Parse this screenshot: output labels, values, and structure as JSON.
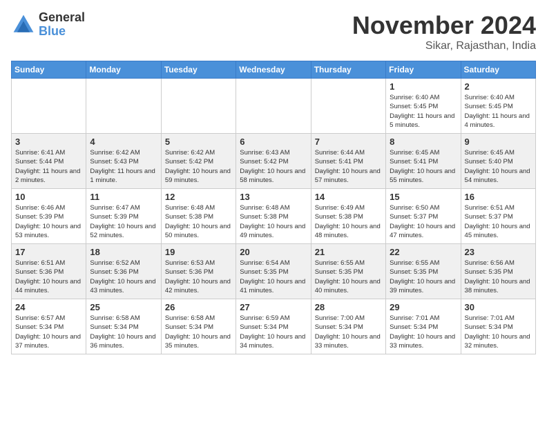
{
  "logo": {
    "general": "General",
    "blue": "Blue"
  },
  "title": "November 2024",
  "location": "Sikar, Rajasthan, India",
  "days_of_week": [
    "Sunday",
    "Monday",
    "Tuesday",
    "Wednesday",
    "Thursday",
    "Friday",
    "Saturday"
  ],
  "weeks": [
    [
      {
        "day": "",
        "info": ""
      },
      {
        "day": "",
        "info": ""
      },
      {
        "day": "",
        "info": ""
      },
      {
        "day": "",
        "info": ""
      },
      {
        "day": "",
        "info": ""
      },
      {
        "day": "1",
        "info": "Sunrise: 6:40 AM\nSunset: 5:45 PM\nDaylight: 11 hours\nand 5 minutes."
      },
      {
        "day": "2",
        "info": "Sunrise: 6:40 AM\nSunset: 5:45 PM\nDaylight: 11 hours\nand 4 minutes."
      }
    ],
    [
      {
        "day": "3",
        "info": "Sunrise: 6:41 AM\nSunset: 5:44 PM\nDaylight: 11 hours\nand 2 minutes."
      },
      {
        "day": "4",
        "info": "Sunrise: 6:42 AM\nSunset: 5:43 PM\nDaylight: 11 hours\nand 1 minute."
      },
      {
        "day": "5",
        "info": "Sunrise: 6:42 AM\nSunset: 5:42 PM\nDaylight: 10 hours\nand 59 minutes."
      },
      {
        "day": "6",
        "info": "Sunrise: 6:43 AM\nSunset: 5:42 PM\nDaylight: 10 hours\nand 58 minutes."
      },
      {
        "day": "7",
        "info": "Sunrise: 6:44 AM\nSunset: 5:41 PM\nDaylight: 10 hours\nand 57 minutes."
      },
      {
        "day": "8",
        "info": "Sunrise: 6:45 AM\nSunset: 5:41 PM\nDaylight: 10 hours\nand 55 minutes."
      },
      {
        "day": "9",
        "info": "Sunrise: 6:45 AM\nSunset: 5:40 PM\nDaylight: 10 hours\nand 54 minutes."
      }
    ],
    [
      {
        "day": "10",
        "info": "Sunrise: 6:46 AM\nSunset: 5:39 PM\nDaylight: 10 hours\nand 53 minutes."
      },
      {
        "day": "11",
        "info": "Sunrise: 6:47 AM\nSunset: 5:39 PM\nDaylight: 10 hours\nand 52 minutes."
      },
      {
        "day": "12",
        "info": "Sunrise: 6:48 AM\nSunset: 5:38 PM\nDaylight: 10 hours\nand 50 minutes."
      },
      {
        "day": "13",
        "info": "Sunrise: 6:48 AM\nSunset: 5:38 PM\nDaylight: 10 hours\nand 49 minutes."
      },
      {
        "day": "14",
        "info": "Sunrise: 6:49 AM\nSunset: 5:38 PM\nDaylight: 10 hours\nand 48 minutes."
      },
      {
        "day": "15",
        "info": "Sunrise: 6:50 AM\nSunset: 5:37 PM\nDaylight: 10 hours\nand 47 minutes."
      },
      {
        "day": "16",
        "info": "Sunrise: 6:51 AM\nSunset: 5:37 PM\nDaylight: 10 hours\nand 45 minutes."
      }
    ],
    [
      {
        "day": "17",
        "info": "Sunrise: 6:51 AM\nSunset: 5:36 PM\nDaylight: 10 hours\nand 44 minutes."
      },
      {
        "day": "18",
        "info": "Sunrise: 6:52 AM\nSunset: 5:36 PM\nDaylight: 10 hours\nand 43 minutes."
      },
      {
        "day": "19",
        "info": "Sunrise: 6:53 AM\nSunset: 5:36 PM\nDaylight: 10 hours\nand 42 minutes."
      },
      {
        "day": "20",
        "info": "Sunrise: 6:54 AM\nSunset: 5:35 PM\nDaylight: 10 hours\nand 41 minutes."
      },
      {
        "day": "21",
        "info": "Sunrise: 6:55 AM\nSunset: 5:35 PM\nDaylight: 10 hours\nand 40 minutes."
      },
      {
        "day": "22",
        "info": "Sunrise: 6:55 AM\nSunset: 5:35 PM\nDaylight: 10 hours\nand 39 minutes."
      },
      {
        "day": "23",
        "info": "Sunrise: 6:56 AM\nSunset: 5:35 PM\nDaylight: 10 hours\nand 38 minutes."
      }
    ],
    [
      {
        "day": "24",
        "info": "Sunrise: 6:57 AM\nSunset: 5:34 PM\nDaylight: 10 hours\nand 37 minutes."
      },
      {
        "day": "25",
        "info": "Sunrise: 6:58 AM\nSunset: 5:34 PM\nDaylight: 10 hours\nand 36 minutes."
      },
      {
        "day": "26",
        "info": "Sunrise: 6:58 AM\nSunset: 5:34 PM\nDaylight: 10 hours\nand 35 minutes."
      },
      {
        "day": "27",
        "info": "Sunrise: 6:59 AM\nSunset: 5:34 PM\nDaylight: 10 hours\nand 34 minutes."
      },
      {
        "day": "28",
        "info": "Sunrise: 7:00 AM\nSunset: 5:34 PM\nDaylight: 10 hours\nand 33 minutes."
      },
      {
        "day": "29",
        "info": "Sunrise: 7:01 AM\nSunset: 5:34 PM\nDaylight: 10 hours\nand 33 minutes."
      },
      {
        "day": "30",
        "info": "Sunrise: 7:01 AM\nSunset: 5:34 PM\nDaylight: 10 hours\nand 32 minutes."
      }
    ]
  ]
}
